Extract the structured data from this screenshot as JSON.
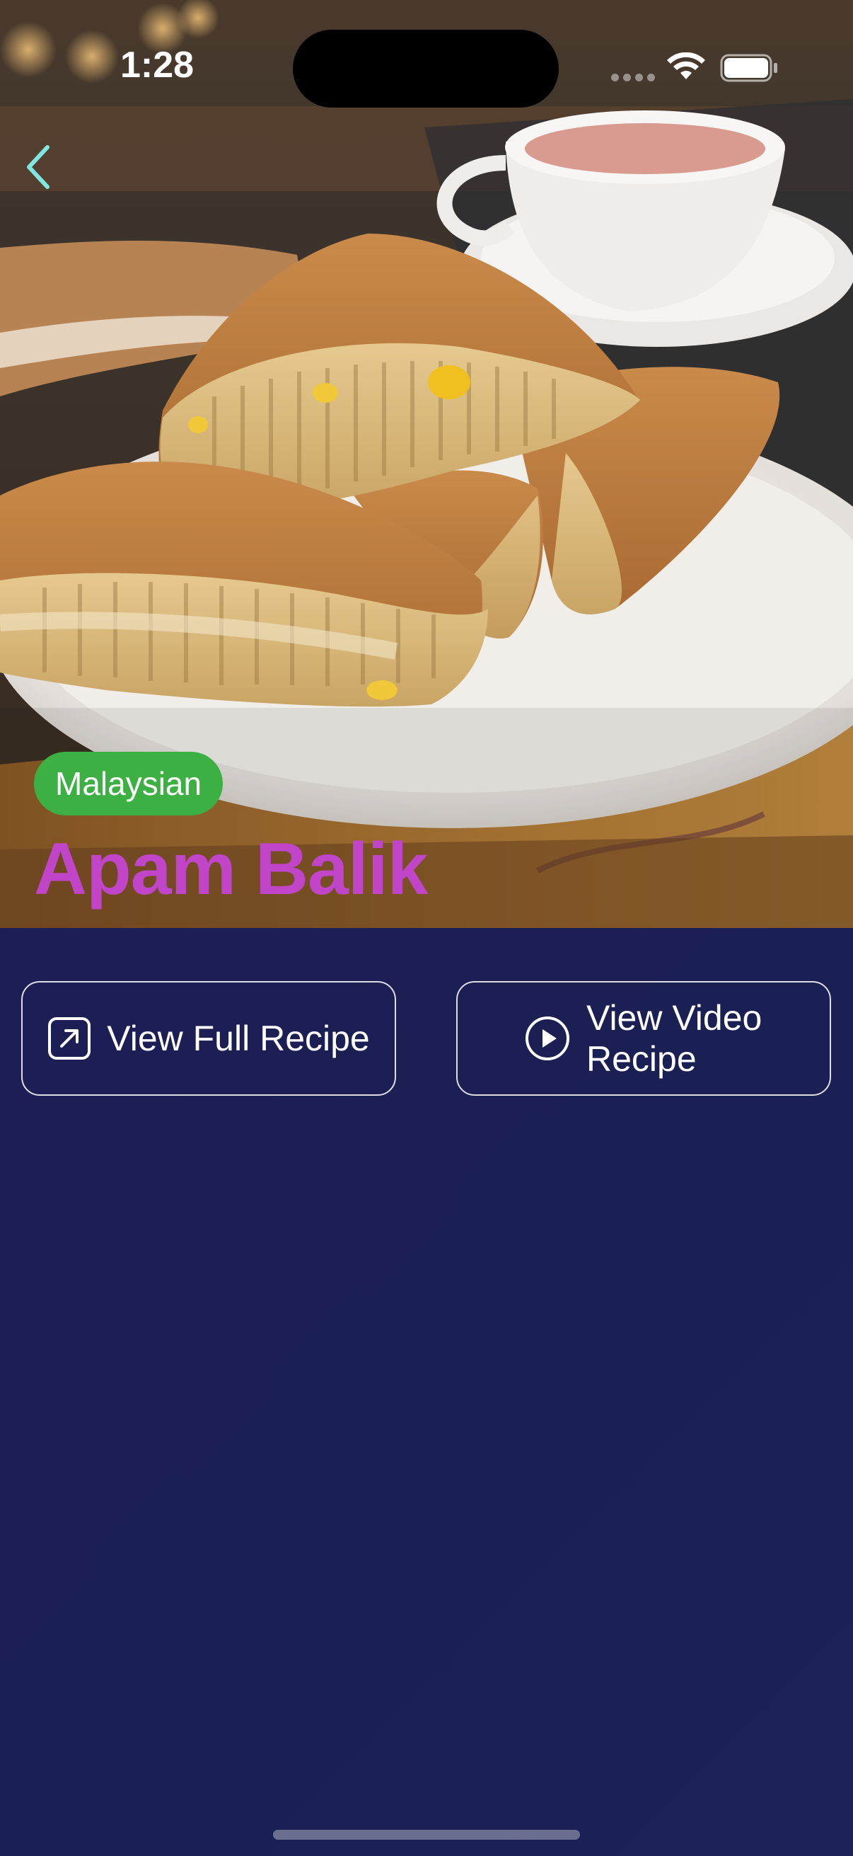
{
  "status_bar": {
    "time": "1:28"
  },
  "navigation": {
    "back_icon": "chevron-left-icon",
    "back_color": "#7fe6e0"
  },
  "recipe": {
    "cuisine": "Malaysian",
    "title": "Apam Balik",
    "tag_color": "#3db043",
    "title_color": "#c145c8"
  },
  "actions": {
    "full_recipe": {
      "label": "View Full Recipe",
      "icon": "external-link-icon"
    },
    "video_recipe": {
      "label": "View Video Recipe",
      "icon": "play-circle-icon"
    }
  },
  "theme": {
    "background_start": "#2a1559",
    "background_end": "#1c2256"
  }
}
